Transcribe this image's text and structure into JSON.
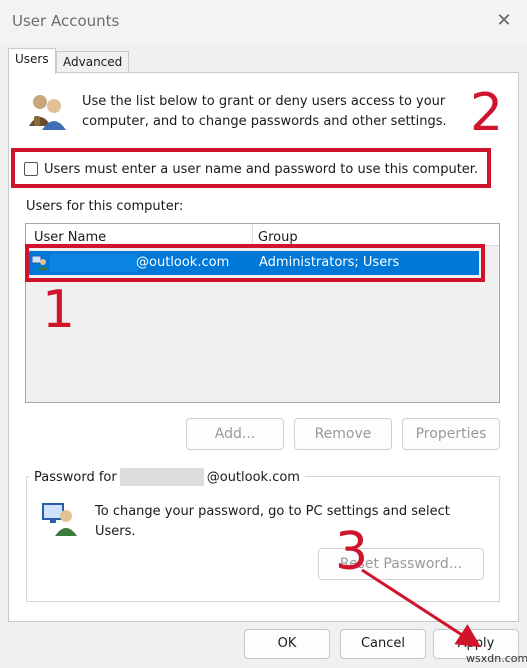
{
  "window": {
    "title": "User Accounts"
  },
  "tabs": [
    {
      "label": "Users",
      "active": true
    },
    {
      "label": "Advanced",
      "active": false
    }
  ],
  "intro_text": "Use the list below to grant or deny users access to your computer, and to change passwords and other settings.",
  "checkbox": {
    "label": "Users must enter a user name and password to use this computer.",
    "checked": false
  },
  "users_section": {
    "label": "Users for this computer:",
    "columns": [
      "User Name",
      "Group"
    ],
    "rows": [
      {
        "user_name": "@outlook.com",
        "group": "Administrators; Users",
        "selected": true
      }
    ]
  },
  "list_buttons": {
    "add": "Add...",
    "remove": "Remove",
    "properties": "Properties"
  },
  "password_group": {
    "label_prefix": "Password for",
    "label_suffix": "@outlook.com",
    "text": "To change your password, go to PC settings and select Users.",
    "reset_button": "Reset Password..."
  },
  "footer": {
    "ok": "OK",
    "cancel": "Cancel",
    "apply": "Apply"
  },
  "annotations": {
    "one": "1",
    "two": "2",
    "three": "3"
  },
  "watermark": "wsxdn.com",
  "colors": {
    "highlight": "#0078d7",
    "annotation": "#d0142c"
  },
  "icons": {
    "users": "users-icon",
    "pc_user": "pc-user-icon",
    "close": "close-icon"
  }
}
